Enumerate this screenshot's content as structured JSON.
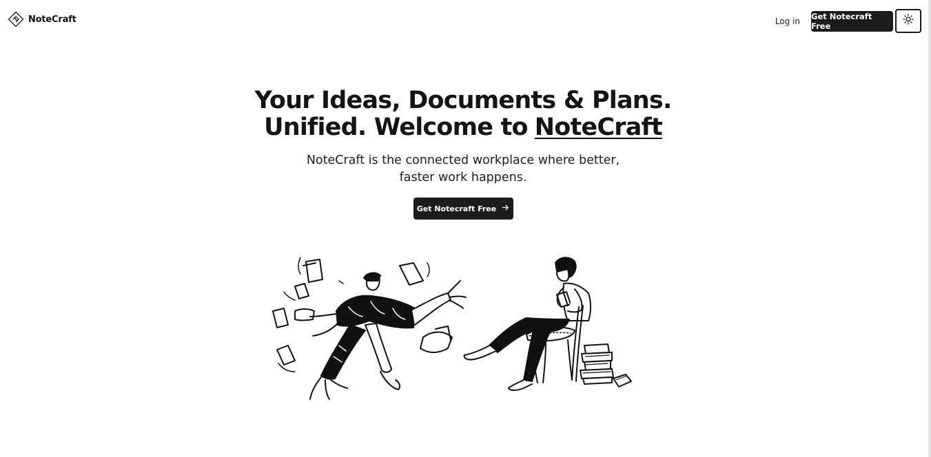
{
  "header": {
    "logo_text": "NoteCraft",
    "logo_icon": "diamond-logo-icon",
    "login_label": "Log in",
    "cta_label": "Get Notecraft Free",
    "theme_toggle_icon": "sun-icon"
  },
  "hero": {
    "title_line1": "Your Ideas, Documents & Plans.",
    "title_line2_prefix": "Unified. Welcome to",
    "title_brand": "NoteCraft",
    "subtitle": "NoteCraft is the connected workplace where better, faster work happens.",
    "cta_label": "Get Notecraft Free",
    "cta_icon": "arrow-right-icon"
  },
  "illustration": {
    "left_figure": "running-person-with-papers",
    "right_figure": "person-reading-on-chair"
  },
  "colors": {
    "primary": "#1c1c1c",
    "background": "#ffffff",
    "text": "#111111"
  }
}
